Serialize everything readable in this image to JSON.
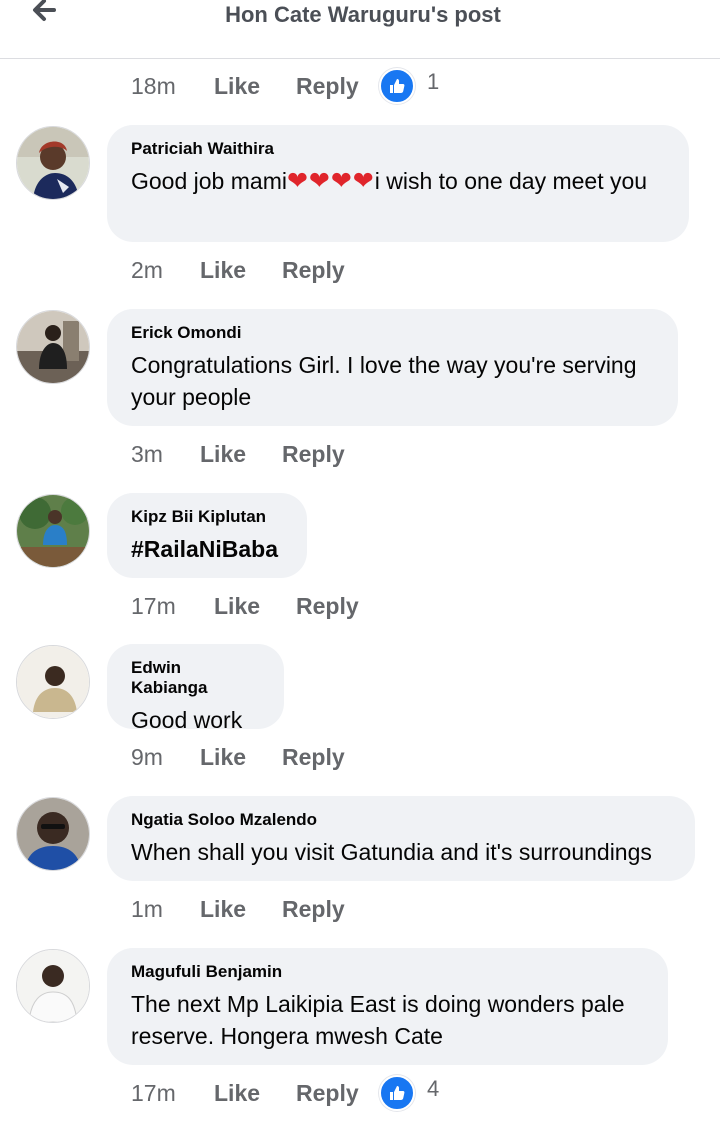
{
  "header": {
    "title": "Hon Cate Waruguru's post"
  },
  "actions": {
    "like": "Like",
    "reply": "Reply"
  },
  "top_meta": {
    "time": "18m",
    "reactions": "1"
  },
  "comments": [
    {
      "author": "Patriciah Waithira",
      "text_before": "Good job mami",
      "hearts": "❤❤❤❤",
      "text_after": "i wish to one day meet you",
      "time": "2m"
    },
    {
      "author": "Erick Omondi",
      "text": "Congratulations Girl. I love the way you're serving your people",
      "time": "3m"
    },
    {
      "author": "Kipz Bii Kiplutan",
      "text": "#RailaNiBaba",
      "time": "17m"
    },
    {
      "author": "Edwin Kabianga",
      "text": "Good work",
      "time": "9m"
    },
    {
      "author": "Ngatia Soloo Mzalendo",
      "text": "When shall you visit Gatundia and it's surroundings",
      "time": "1m"
    },
    {
      "author": "Magufuli Benjamin",
      "text": "The next Mp Laikipia East is doing wonders pale reserve. Hongera mwesh Cate",
      "time": "17m",
      "reactions": "4"
    }
  ],
  "colors": {
    "like_blue": "#1877f2",
    "bubble": "#f0f2f5",
    "muted": "#65676b"
  }
}
